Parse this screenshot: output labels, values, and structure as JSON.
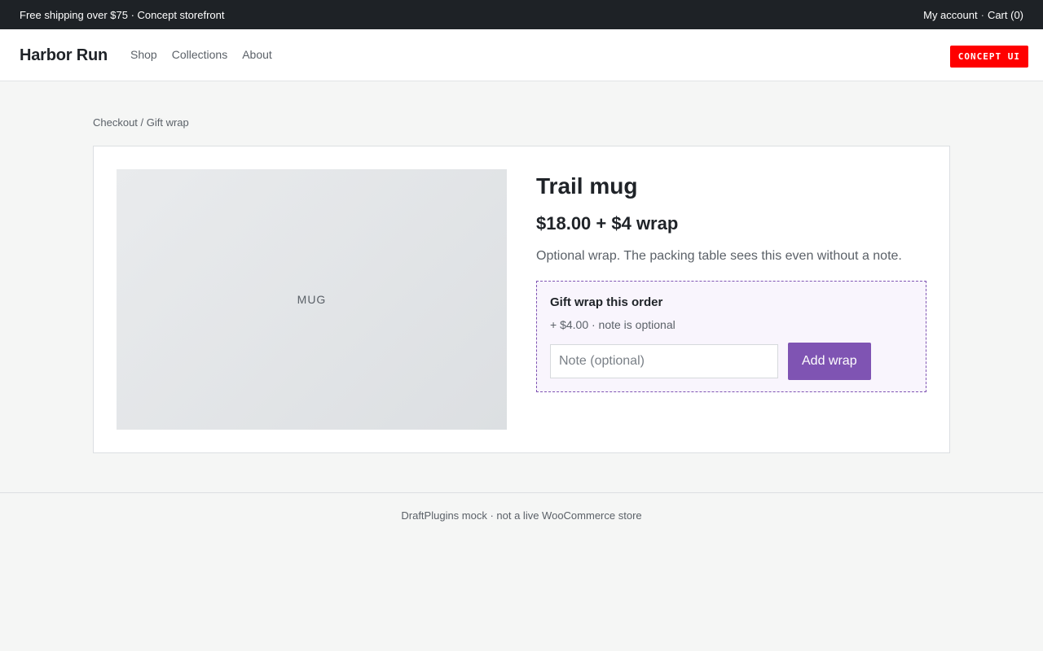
{
  "topbar": {
    "promo": "Free shipping over $75 · Concept storefront",
    "account_link": "My account",
    "separator": "·",
    "cart_link": "Cart (0)"
  },
  "header": {
    "brand": "Harbor Run",
    "nav": [
      {
        "label": "Shop"
      },
      {
        "label": "Collections"
      },
      {
        "label": "About"
      }
    ],
    "badge": "CONCEPT UI"
  },
  "breadcrumb": "Checkout / Gift wrap",
  "product": {
    "image_label": "MUG",
    "title": "Trail mug",
    "price": "$18.00 + $4 wrap",
    "description": "Optional wrap. The packing table sees this even without a note."
  },
  "gift_wrap": {
    "title": "Gift wrap this order",
    "subtitle": "+ $4.00 · note is optional",
    "note_placeholder": "Note (optional)",
    "note_value": "",
    "button_label": "Add wrap"
  },
  "footer": {
    "text": "DraftPlugins mock · not a live WooCommerce store"
  },
  "colors": {
    "accent": "#7f54b3",
    "topbar_bg": "#1e2226",
    "badge_bg": "#ff0000",
    "page_bg": "#f5f6f5"
  }
}
